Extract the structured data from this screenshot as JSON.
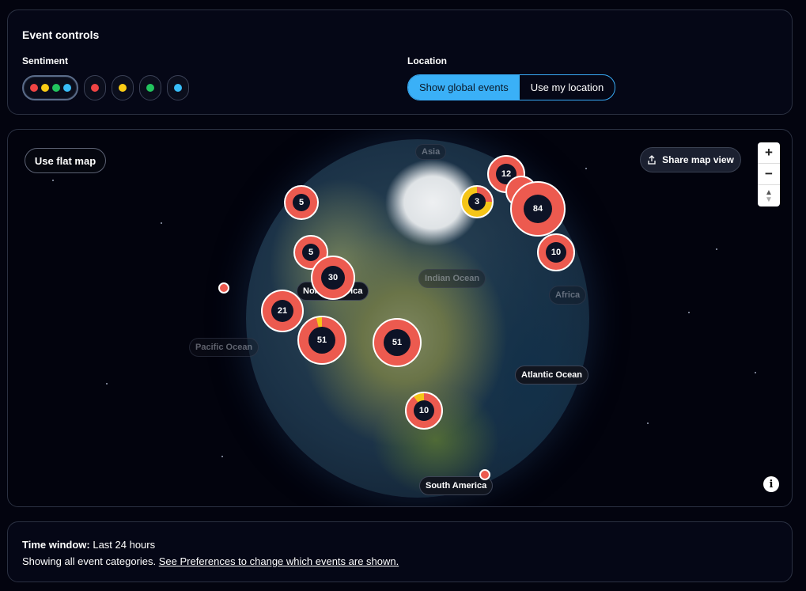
{
  "controls": {
    "title": "Event controls",
    "sentiment_label": "Sentiment",
    "location_label": "Location",
    "sentiment_options": [
      {
        "name": "all",
        "colors": [
          "#ef4444",
          "#facc15",
          "#22c55e",
          "#38bdf8"
        ]
      },
      {
        "name": "negative",
        "color": "#ef4444"
      },
      {
        "name": "neutral",
        "color": "#facc15"
      },
      {
        "name": "positive",
        "color": "#22c55e"
      },
      {
        "name": "info",
        "color": "#38bdf8"
      }
    ],
    "location_options": [
      "Show global events",
      "Use my location"
    ],
    "selected_location": "Show global events"
  },
  "map": {
    "flat_map_label": "Use flat map",
    "share_label": "Share map view",
    "zoom_in": "+",
    "zoom_out": "−",
    "compass": "▲",
    "info_icon": "i",
    "labels": {
      "north_america": "North America",
      "pacific": "Pacific Ocean",
      "atlantic": "Atlantic Ocean",
      "south_america": "South America",
      "indian": "Indian Ocean",
      "africa": "Africa",
      "asia": "Asia"
    },
    "clusters": {
      "c1": "12",
      "c2": "3",
      "c3": "84",
      "c4": "5",
      "c5": "5",
      "c6": "30",
      "c7": "10",
      "c8": "21",
      "c9": "51",
      "c10": "51",
      "c11": "10"
    },
    "negative_color": "#ec5a4f",
    "neutral_color": "#f5c518"
  },
  "time": {
    "window_label": "Time window:",
    "window_value": "Last 24 hours",
    "categories_text": "Showing all event categories.",
    "prefs_link": "See Preferences to change which events are shown."
  }
}
